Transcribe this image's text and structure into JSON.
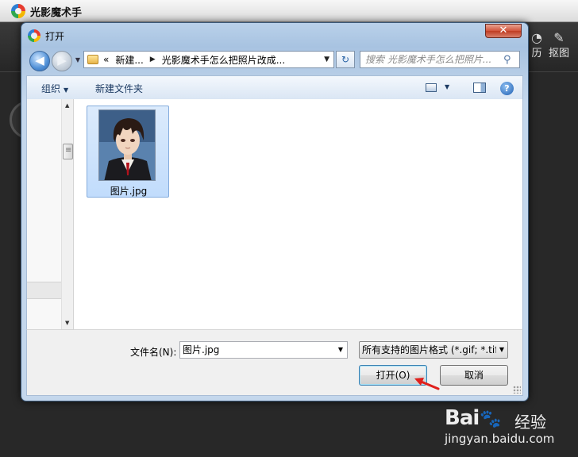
{
  "app": {
    "title": "光影魔术手",
    "toolbar": [
      {
        "label": "历",
        "icon": "history-icon"
      },
      {
        "label": "抠图",
        "icon": "cutout-pin-icon"
      }
    ]
  },
  "dialog": {
    "title": "打开",
    "close_label": "✕",
    "nav": {
      "back_glyph": "◀",
      "forward_glyph": "▶",
      "history_glyph": "▼",
      "address": {
        "prefix": "«",
        "crumbs": [
          "新建...",
          "光影魔术手怎么把照片改成..."
        ],
        "separator": "▶",
        "drop_glyph": "▼"
      },
      "refresh_glyph": "↻",
      "search_placeholder": "搜索 光影魔术手怎么把照片...",
      "search_icon_glyph": "⚲"
    },
    "commands": {
      "organize": "组织",
      "new_folder": "新建文件夹",
      "arrow_glyph": "▼",
      "help_glyph": "?"
    },
    "scroll": {
      "up_glyph": "▲",
      "down_glyph": "▼"
    },
    "files": [
      {
        "name": "图片.jpg",
        "selected": true
      }
    ],
    "bottom": {
      "filename_label": "文件名(N):",
      "filename_value": "图片.jpg",
      "filetype_value": "所有支持的图片格式 (*.gif; *.tif",
      "drop_glyph": "▼",
      "open_label": "打开(O)",
      "cancel_label": "取消"
    }
  },
  "watermark": {
    "brand_left": "Bai",
    "brand_paw": "🐾",
    "brand_right": "经验",
    "url": "jingyan.baidu.com"
  },
  "colors": {
    "selection": "#c1dcfc",
    "accent_arrow": "#e0201c",
    "close_button": "#c03c22"
  }
}
